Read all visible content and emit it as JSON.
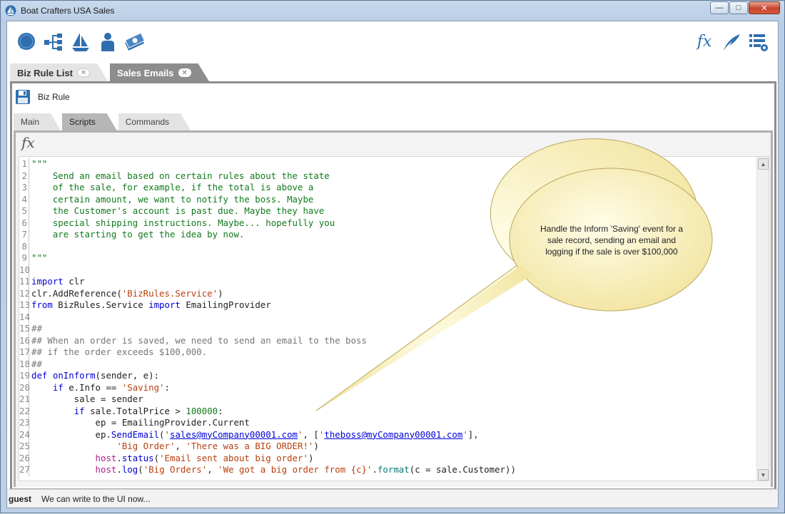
{
  "window": {
    "title": "Boat Crafters USA Sales"
  },
  "toolbar": {
    "left_icons": [
      "chat-icon",
      "hierarchy-icon",
      "sailboat-icon",
      "person-icon",
      "money-icon"
    ],
    "right_icons": [
      "function-icon",
      "feather-icon",
      "list-settings-icon"
    ],
    "fx_glyph": "fx"
  },
  "doc_tabs": [
    {
      "label": "Biz Rule List",
      "active": false
    },
    {
      "label": "Sales Emails",
      "active": true
    }
  ],
  "doc": {
    "save_label": "Biz Rule"
  },
  "inner_tabs": [
    {
      "label": "Main",
      "active": false
    },
    {
      "label": "Scripts",
      "active": true
    },
    {
      "label": "Commands",
      "active": false
    }
  ],
  "script_header": {
    "fx_glyph": "fx"
  },
  "code_lines": [
    [
      [
        "doc",
        "\"\"\""
      ]
    ],
    [
      [
        "doc",
        "    Send an email based on certain rules about the state"
      ]
    ],
    [
      [
        "doc",
        "    of the sale, for example, if the total is above a"
      ]
    ],
    [
      [
        "doc",
        "    certain amount, we want to notify the boss. Maybe"
      ]
    ],
    [
      [
        "doc",
        "    the Customer's account is past due. Maybe they have"
      ]
    ],
    [
      [
        "doc",
        "    special shipping instructions. Maybe... hopefully you"
      ]
    ],
    [
      [
        "doc",
        "    are starting to get the idea by now."
      ]
    ],
    [
      [
        "txt",
        ""
      ]
    ],
    [
      [
        "doc",
        "\"\"\""
      ]
    ],
    [
      [
        "txt",
        ""
      ]
    ],
    [
      [
        "kw",
        "import"
      ],
      [
        "txt",
        " clr"
      ]
    ],
    [
      [
        "txt",
        "clr.AddReference("
      ],
      [
        "str",
        "'BizRules.Service'"
      ],
      [
        "txt",
        ")"
      ]
    ],
    [
      [
        "kw",
        "from"
      ],
      [
        "txt",
        " BizRules.Service "
      ],
      [
        "kw",
        "import"
      ],
      [
        "txt",
        " EmailingProvider"
      ]
    ],
    [
      [
        "txt",
        ""
      ]
    ],
    [
      [
        "cm",
        "##"
      ]
    ],
    [
      [
        "cm",
        "## When an order is saved, we need to send an email to the boss"
      ]
    ],
    [
      [
        "cm",
        "## if the order exceeds $100,000."
      ]
    ],
    [
      [
        "cm",
        "##"
      ]
    ],
    [
      [
        "kw",
        "def"
      ],
      [
        "txt",
        " "
      ],
      [
        "kw",
        "onInform"
      ],
      [
        "txt",
        "(sender, e):"
      ]
    ],
    [
      [
        "txt",
        "    "
      ],
      [
        "kw",
        "if"
      ],
      [
        "txt",
        " e.Info == "
      ],
      [
        "str",
        "'Saving'"
      ],
      [
        "txt",
        ":"
      ]
    ],
    [
      [
        "txt",
        "        sale = sender"
      ]
    ],
    [
      [
        "txt",
        "        "
      ],
      [
        "kw",
        "if"
      ],
      [
        "txt",
        " sale.TotalPrice > "
      ],
      [
        "doc",
        "100000"
      ],
      [
        "txt",
        ":"
      ]
    ],
    [
      [
        "txt",
        "            ep = EmailingProvider.Current"
      ]
    ],
    [
      [
        "txt",
        "            ep."
      ],
      [
        "kw",
        "SendEmail"
      ],
      [
        "txt",
        "("
      ],
      [
        "str",
        "'"
      ],
      [
        "lnk",
        "sales@myCompany00001.com"
      ],
      [
        "str",
        "'"
      ],
      [
        "txt",
        ", ["
      ],
      [
        "str",
        "'"
      ],
      [
        "lnk",
        "theboss@myCompany00001.com"
      ],
      [
        "str",
        "'"
      ],
      [
        "txt",
        "],"
      ]
    ],
    [
      [
        "txt",
        "                "
      ],
      [
        "str",
        "'Big Order'"
      ],
      [
        "txt",
        ", "
      ],
      [
        "str",
        "'There was a BIG ORDER!'"
      ],
      [
        "txt",
        ")"
      ]
    ],
    [
      [
        "txt",
        "            "
      ],
      [
        "host",
        "host"
      ],
      [
        "txt",
        "."
      ],
      [
        "kw",
        "status"
      ],
      [
        "txt",
        "("
      ],
      [
        "str",
        "'Email sent about big order'"
      ],
      [
        "txt",
        ")"
      ]
    ],
    [
      [
        "txt",
        "            "
      ],
      [
        "host",
        "host"
      ],
      [
        "txt",
        "."
      ],
      [
        "kw",
        "log"
      ],
      [
        "txt",
        "("
      ],
      [
        "str",
        "'Big Orders'"
      ],
      [
        "txt",
        ", "
      ],
      [
        "str",
        "'We got a big order from {c}'"
      ],
      [
        "txt",
        "."
      ],
      [
        "fn",
        "format"
      ],
      [
        "txt",
        "(c = sale.Customer))"
      ]
    ]
  ],
  "callout": {
    "text": "Handle the Inform 'Saving' event for a sale record, sending an email and logging if the sale is over $100,000"
  },
  "status": {
    "user": "guest",
    "message": "We can write to the UI now..."
  }
}
